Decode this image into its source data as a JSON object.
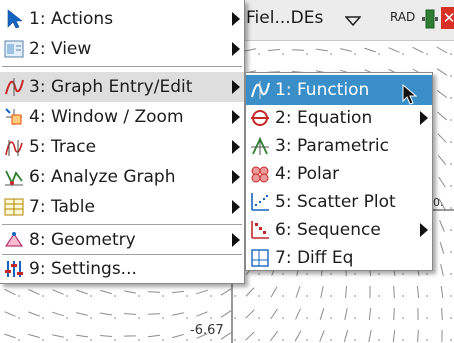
{
  "status_bar": {
    "doc_title": "Fiel...DEs",
    "angle_mode": "RAD",
    "close_glyph": "✕"
  },
  "graph": {
    "y_tick_label": "-6.67",
    "x_tick_stub": "0."
  },
  "main_menu": {
    "items": [
      {
        "label": "1: Actions",
        "icon": "cursor-arrow-icon"
      },
      {
        "label": "2: View",
        "icon": "view-icon"
      },
      {
        "label": "3: Graph Entry/Edit",
        "icon": "graph-entry-icon"
      },
      {
        "label": "4: Window / Zoom",
        "icon": "window-zoom-icon"
      },
      {
        "label": "5: Trace",
        "icon": "trace-icon"
      },
      {
        "label": "6: Analyze Graph",
        "icon": "analyze-graph-icon"
      },
      {
        "label": "7: Table",
        "icon": "table-icon"
      },
      {
        "label": "8: Geometry",
        "icon": "geometry-icon"
      },
      {
        "label": "9: Settings...",
        "icon": "settings-icon"
      }
    ]
  },
  "sub_menu": {
    "items": [
      {
        "label": "1: Function",
        "icon": "function-icon"
      },
      {
        "label": "2: Equation",
        "icon": "equation-icon"
      },
      {
        "label": "3: Parametric",
        "icon": "parametric-icon"
      },
      {
        "label": "4: Polar",
        "icon": "polar-icon"
      },
      {
        "label": "5: Scatter Plot",
        "icon": "scatter-plot-icon"
      },
      {
        "label": "6: Sequence",
        "icon": "sequence-icon"
      },
      {
        "label": "7: Diff Eq",
        "icon": "diff-eq-icon"
      }
    ]
  },
  "colors": {
    "selected": "#3a8fc8",
    "highlight": "#dedede",
    "close": "#d93025"
  }
}
